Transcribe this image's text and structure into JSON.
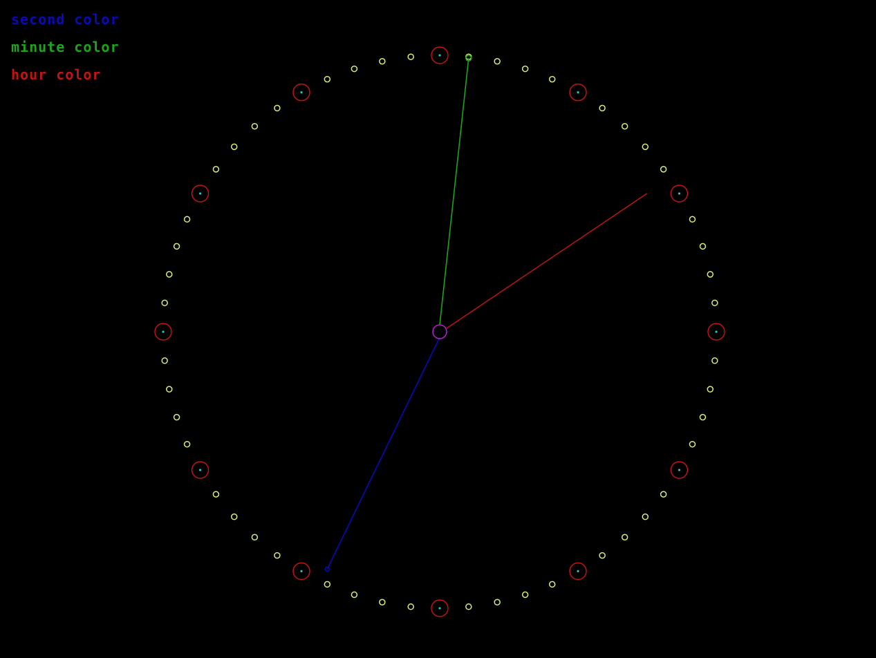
{
  "legend": {
    "second_label": "second color",
    "minute_label": "minute color",
    "hour_label": "hour color"
  },
  "colors": {
    "background": "#000000",
    "second": "#0a0ab8",
    "minute": "#1fa31f",
    "hour": "#c21414",
    "tick": "#d6f07a",
    "hour_marker": "#c21414",
    "hour_marker_dot": "#29c4c4",
    "center": "#b020c8"
  },
  "clock": {
    "tick_count": 60,
    "hour_marker_count": 12,
    "hands": {
      "hour": {
        "value": 2.0,
        "unit": "hours"
      },
      "minute": {
        "value": 1,
        "unit": "minutes"
      },
      "second": {
        "value": 34,
        "unit": "seconds"
      }
    }
  }
}
